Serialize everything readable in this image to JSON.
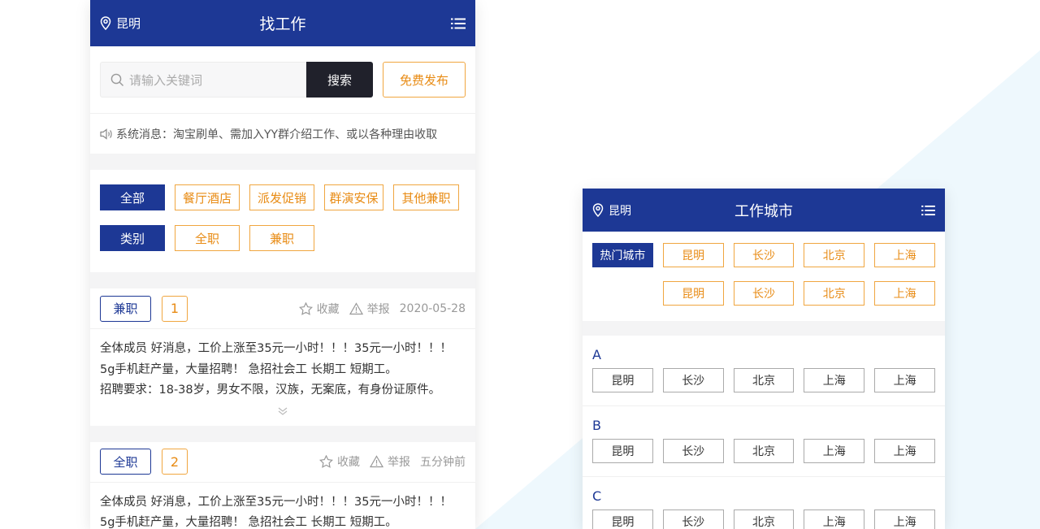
{
  "colors": {
    "brand": "#1d3895",
    "accent": "#e88b14",
    "dark_button": "#20212b"
  },
  "job_page": {
    "header": {
      "location": "昆明",
      "title": "找工作",
      "location_icon": "location-pin-icon",
      "menu_icon": "list-menu-icon"
    },
    "search": {
      "placeholder": "请输入关键词",
      "button": "搜索",
      "publish": "免费发布"
    },
    "notice": "系统消息：淘宝刷单、需加入YY群介绍工作、或以各种理由收取",
    "filters": {
      "row1": [
        "全部",
        "餐厅酒店",
        "派发促销",
        "群演安保",
        "其他兼职"
      ],
      "row2": [
        "类别",
        "全职",
        "兼职"
      ]
    },
    "jobs": [
      {
        "type": "兼职",
        "num": "1",
        "fav": "收藏",
        "report": "举报",
        "date": "2020-05-28",
        "lines": [
          "全体成员 好消息，工价上涨至35元一小时！！！35元一小时！！！",
          "5g手机赶产量，大量招聘！ 急招社会工 长期工 短期工。",
          "招聘要求：18-38岁，男女不限，汉族，无案底，有身份证原件。"
        ]
      },
      {
        "type": "全职",
        "num": "2",
        "fav": "收藏",
        "report": "举报",
        "date": "五分钟前",
        "lines": [
          "全体成员 好消息，工价上涨至35元一小时！！！35元一小时！！！",
          "5g手机赶产量，大量招聘！ 急招社会工 长期工 短期工。"
        ]
      }
    ]
  },
  "city_page": {
    "header": {
      "location": "昆明",
      "title": "工作城市"
    },
    "hot_label": "热门城市",
    "hot_row1": [
      "昆明",
      "长沙",
      "北京",
      "上海"
    ],
    "hot_row2": [
      "昆明",
      "长沙",
      "北京",
      "上海"
    ],
    "sections": [
      {
        "letter": "A",
        "cities": [
          "昆明",
          "长沙",
          "北京",
          "上海",
          "上海"
        ]
      },
      {
        "letter": "B",
        "cities": [
          "昆明",
          "长沙",
          "北京",
          "上海",
          "上海"
        ]
      },
      {
        "letter": "C",
        "cities": [
          "昆明",
          "长沙",
          "北京",
          "上海",
          "上海"
        ]
      }
    ]
  }
}
